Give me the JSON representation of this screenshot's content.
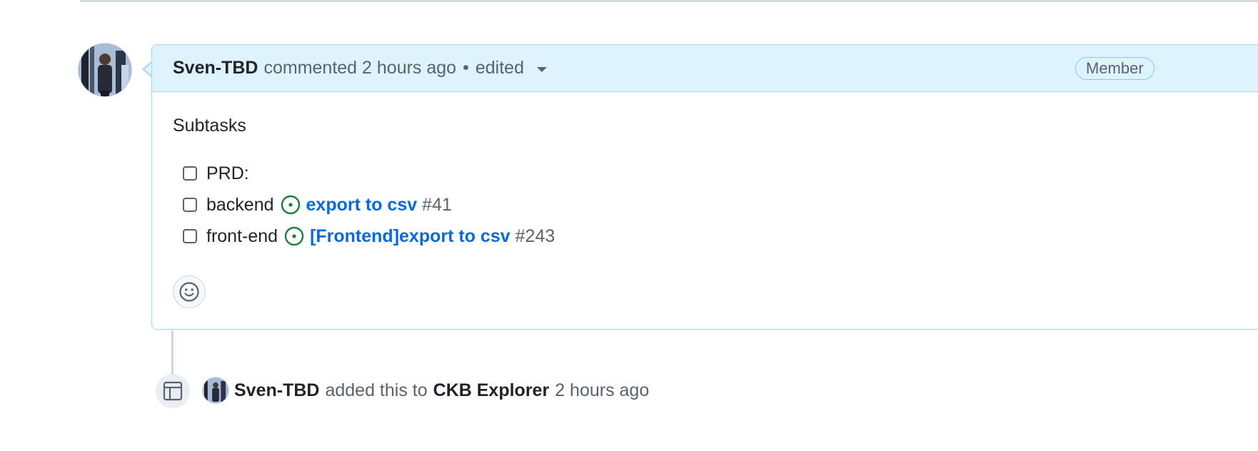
{
  "comment": {
    "author": "Sven-TBD",
    "action": "commented",
    "time": "2 hours ago",
    "separator": "•",
    "edited_label": "edited",
    "role_badge": "Member",
    "body_title": "Subtasks",
    "tasks": [
      {
        "label": "PRD:"
      },
      {
        "label": "backend",
        "issue_title": "export to csv",
        "issue_number": "#41"
      },
      {
        "label": "front-end",
        "issue_title": "[Frontend]export to csv",
        "issue_number": "#243"
      }
    ],
    "reaction_icon": "smiley-icon"
  },
  "event": {
    "icon": "project-table-icon",
    "author": "Sven-TBD",
    "text": "added this to",
    "project": "CKB Explorer",
    "time": "2 hours ago"
  },
  "colors": {
    "header_bg": "#ddf4ff",
    "header_border": "#a9d4f5",
    "link": "#0969da",
    "open_issue": "#1a7f37",
    "muted": "#59636e"
  }
}
